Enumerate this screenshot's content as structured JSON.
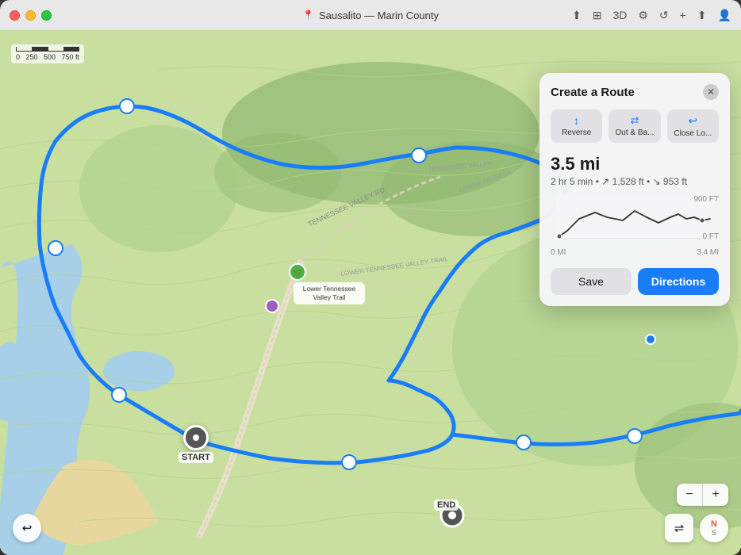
{
  "window": {
    "title": "Sausalito — Marin County",
    "titlebar_icon": "📍"
  },
  "titlebar_controls": [
    "↑↓",
    "⊞",
    "3D",
    "⚙",
    "↺",
    "+",
    "⬆",
    "👤"
  ],
  "scale": {
    "labels": [
      "0",
      "250",
      "500",
      "750 ft"
    ]
  },
  "panel": {
    "title": "Create a Route",
    "close_label": "✕",
    "actions": [
      {
        "icon": "↕",
        "label": "Reverse"
      },
      {
        "icon": "S",
        "label": "Out & Ba..."
      },
      {
        "icon": "↺",
        "label": "Close Lo..."
      }
    ],
    "distance": "3.5 mi",
    "details": "2 hr 5 min • ↗ 1,528 ft • ↘ 953 ft",
    "elevation": {
      "x_labels": [
        "0 MI",
        "3.4 MI"
      ],
      "y_labels": [
        "900 FT",
        "0 FT"
      ]
    },
    "save_label": "Save",
    "directions_label": "Directions"
  },
  "markers": {
    "start_label": "START",
    "end_label": "END"
  },
  "map_controls": {
    "back_icon": "↩",
    "filter_icon": "⇌",
    "zoom_minus": "−",
    "zoom_plus": "+",
    "compass_n": "N",
    "compass_s": "S"
  }
}
